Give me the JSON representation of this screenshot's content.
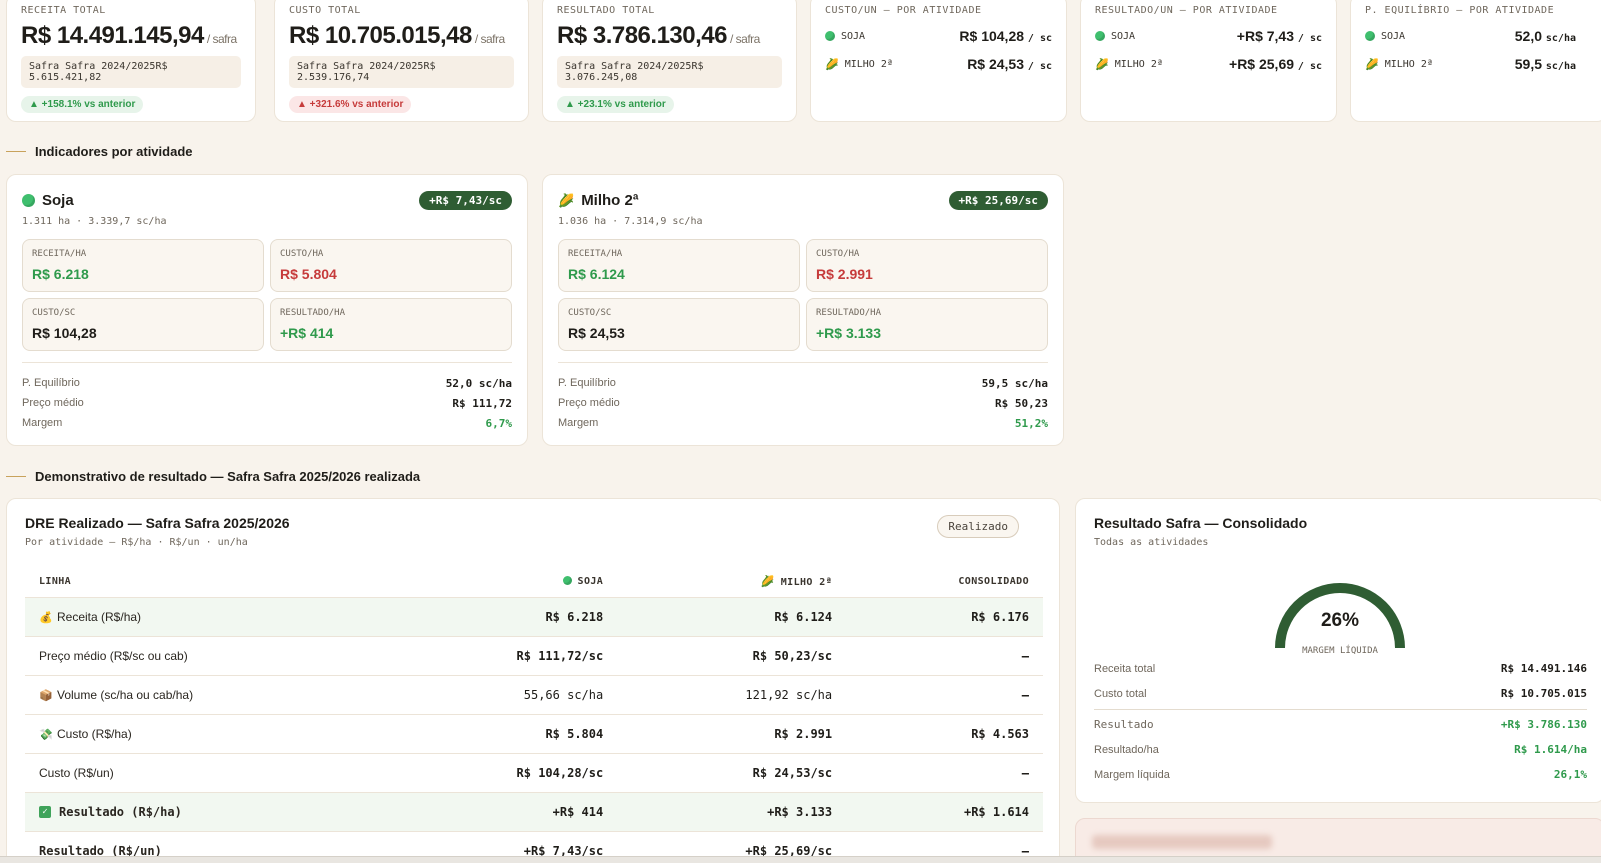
{
  "kpis": {
    "receita": {
      "label": "RECEITA TOTAL",
      "value": "R$ 14.491.145,94",
      "unit": "/ safra",
      "prev_label": "Safra Safra 2024/2025",
      "prev_value": "R$ 5.615.421,82",
      "delta": "▲ +158.1% vs anterior"
    },
    "custo": {
      "label": "CUSTO TOTAL",
      "value": "R$ 10.705.015,48",
      "unit": "/ safra",
      "prev_label": "Safra Safra 2024/2025",
      "prev_value": "R$ 2.539.176,74",
      "delta": "▲ +321.6% vs anterior"
    },
    "resultado": {
      "label": "RESULTADO TOTAL",
      "value": "R$ 3.786.130,46",
      "unit": "/ safra",
      "prev_label": "Safra Safra 2024/2025",
      "prev_value": "R$ 3.076.245,08",
      "delta": "▲ +23.1% vs anterior"
    },
    "custo_un": {
      "label": "CUSTO/UN — POR ATIVIDADE",
      "soja_label": "SOJA",
      "soja_value": "R$ 104,28",
      "milho_label": "MILHO 2ª",
      "milho_value": "R$ 24,53",
      "unit": "/ sc"
    },
    "resultado_un": {
      "label": "RESULTADO/UN — POR ATIVIDADE",
      "soja_label": "SOJA",
      "soja_value": "+R$ 7,43",
      "milho_label": "MILHO 2ª",
      "milho_value": "+R$ 25,69",
      "unit": "/ sc"
    },
    "equilibrio": {
      "label": "P. EQUILÍBRIO — POR ATIVIDADE",
      "soja_label": "SOJA",
      "soja_value": "52,0",
      "milho_label": "MILHO 2ª",
      "milho_value": "59,5",
      "unit": "sc/ha"
    }
  },
  "section_indicadores": "Indicadores por atividade",
  "activities": {
    "soja": {
      "name": "Soja",
      "pill": "+R$ 7,43/sc",
      "sub": "1.311 ha · 3.339,7 sc/ha",
      "receita_label": "RECEITA/HA",
      "receita": "R$ 6.218",
      "custo_label": "CUSTO/HA",
      "custo": "R$ 5.804",
      "custo_sc_label": "CUSTO/SC",
      "custo_sc": "R$ 104,28",
      "resultado_label": "RESULTADO/HA",
      "resultado": "+R$ 414",
      "equilibrio_label": "P. Equilíbrio",
      "equilibrio": "52,0 sc/ha",
      "preco_label": "Preço médio",
      "preco": "R$ 111,72",
      "margem_label": "Margem",
      "margem": "6,7%"
    },
    "milho": {
      "name": "Milho 2ª",
      "pill": "+R$ 25,69/sc",
      "sub": "1.036 ha · 7.314,9 sc/ha",
      "receita_label": "RECEITA/HA",
      "receita": "R$ 6.124",
      "custo_label": "CUSTO/HA",
      "custo": "R$ 2.991",
      "custo_sc_label": "CUSTO/SC",
      "custo_sc": "R$ 24,53",
      "resultado_label": "RESULTADO/HA",
      "resultado": "+R$ 3.133",
      "equilibrio_label": "P. Equilíbrio",
      "equilibrio": "59,5 sc/ha",
      "preco_label": "Preço médio",
      "preco": "R$ 50,23",
      "margem_label": "Margem",
      "margem": "51,2%"
    }
  },
  "section_dre": "Demonstrativo de resultado — Safra Safra 2025/2026 realizada",
  "dre": {
    "title": "DRE Realizado — Safra Safra 2025/2026",
    "subtitle": "Por atividade — R$/ha · R$/un · un/ha",
    "badge": "Realizado",
    "headers": {
      "linha": "LINHA",
      "soja": "SOJA",
      "milho": "MILHO 2ª",
      "consolidado": "CONSOLIDADO"
    },
    "rows": [
      {
        "label": "Receita (R$/ha)",
        "icon": "money-bag-icon",
        "soja": "R$ 6.218",
        "milho": "R$ 6.124",
        "cons": "R$ 6.176"
      },
      {
        "label": "Preço médio (R$/sc ou cab)",
        "icon": "",
        "soja": "R$ 111,72/sc",
        "milho": "R$ 50,23/sc",
        "cons": "–"
      },
      {
        "label": "Volume (sc/ha ou cab/ha)",
        "icon": "package-icon",
        "soja": "55,66 sc/ha",
        "milho": "121,92 sc/ha",
        "cons": "–"
      },
      {
        "label": "Custo (R$/ha)",
        "icon": "money-wings-icon",
        "soja": "R$ 5.804",
        "milho": "R$ 2.991",
        "cons": "R$ 4.563"
      },
      {
        "label": "Custo (R$/un)",
        "icon": "",
        "soja": "R$ 104,28/sc",
        "milho": "R$ 24,53/sc",
        "cons": "–"
      },
      {
        "label": "Resultado (R$/ha)",
        "icon": "check-icon",
        "soja": "+R$ 414",
        "milho": "+R$ 3.133",
        "cons": "+R$ 1.614"
      },
      {
        "label": "Resultado (R$/un)",
        "icon": "",
        "soja": "+R$ 7,43/sc",
        "milho": "+R$ 25,69/sc",
        "cons": "–"
      }
    ]
  },
  "consolidado": {
    "title": "Resultado Safra — Consolidado",
    "subtitle": "Todas as atividades",
    "gauge_pct": "26%",
    "gauge_value": 0.261,
    "gauge_label": "MARGEM LÍQUIDA",
    "receita_label": "Receita total",
    "receita": "R$ 14.491.146",
    "custo_label": "Custo total",
    "custo": "R$ 10.705.015",
    "resultado_label": "Resultado",
    "resultado": "+R$ 3.786.130",
    "resultado_ha_label": "Resultado/ha",
    "resultado_ha": "R$ 1.614/ha",
    "margem_label": "Margem líquida",
    "margem": "26,1%"
  },
  "colors": {
    "accent_green": "#2f5d33",
    "positive": "#2f9a4c",
    "negative": "#c63b3b",
    "soja_dot": "#3fbf6e"
  }
}
